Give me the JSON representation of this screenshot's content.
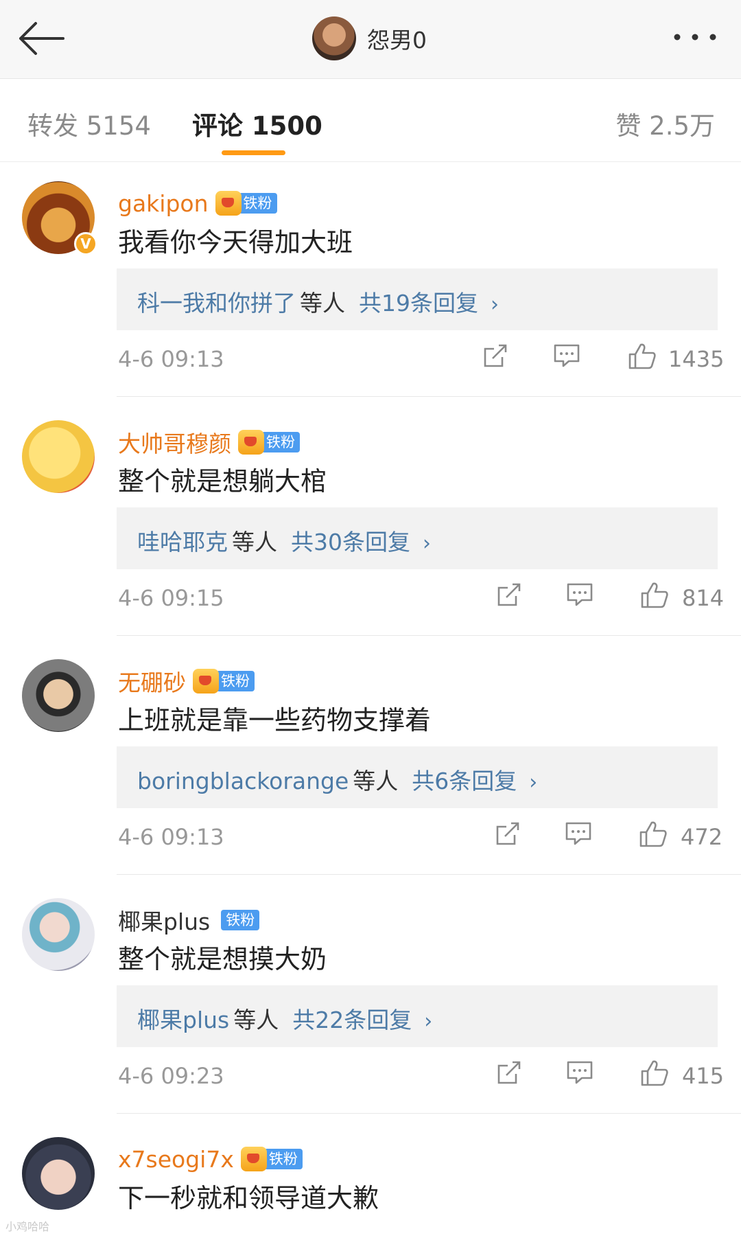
{
  "header": {
    "profile_name": "怨男0"
  },
  "tabs": {
    "repost": "转发 5154",
    "comment": "评论 1500",
    "like": "赞 2.5万"
  },
  "accent_color": "#ff9a14",
  "fan_label": "铁粉",
  "comments": [
    {
      "user": "gakipon",
      "text": "我看你今天得加大班",
      "reply_names": "科一我和你拼了",
      "reply_suffix": "等人",
      "reply_count": "共19条回复",
      "time": "4-6 09:13",
      "likes": "1435",
      "verified_mark": "V"
    },
    {
      "user": "大帅哥穆颜",
      "text": "整个就是想躺大棺",
      "reply_names": "哇哈耶克",
      "reply_suffix": "等人",
      "reply_count": "共30条回复",
      "time": "4-6 09:15",
      "likes": "814"
    },
    {
      "user": "无硼砂",
      "text": "上班就是靠一些药物支撑着",
      "reply_names": "boringblackorange",
      "reply_suffix": "等人",
      "reply_count": "共6条回复",
      "time": "4-6 09:13",
      "likes": "472"
    },
    {
      "user": "椰果plus",
      "text": "整个就是想摸大奶",
      "reply_names": "椰果plus",
      "reply_suffix": "等人",
      "reply_count": "共22条回复",
      "time": "4-6 09:23",
      "likes": "415"
    },
    {
      "user": "x7seogi7x",
      "text": "下一秒就和领导道大歉"
    }
  ],
  "watermark": "小鸡哈哈"
}
